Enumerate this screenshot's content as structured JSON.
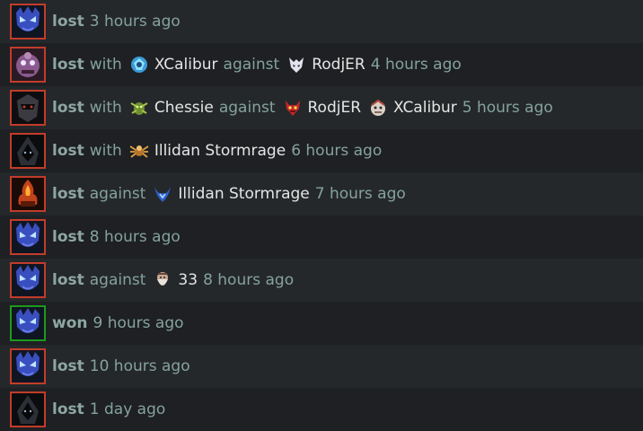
{
  "matches": [
    {
      "result": "lost",
      "time": "3 hours ago",
      "hero_icon": "blue-spirit-hero-icon",
      "frame": "loss"
    },
    {
      "result": "lost",
      "with_label": "with",
      "with": [
        {
          "name": "XCalibur",
          "icon": "blue-orb-hero-icon"
        }
      ],
      "against_label": "against",
      "against": [
        {
          "name": "RodjER",
          "icon": "pale-mask-hero-icon"
        }
      ],
      "time": "4 hours ago",
      "hero_icon": "purple-ogre-hero-icon",
      "frame": "loss"
    },
    {
      "result": "lost",
      "with_label": "with",
      "with": [
        {
          "name": "Chessie",
          "icon": "green-insect-hero-icon"
        }
      ],
      "against_label": "against",
      "against": [
        {
          "name": "RodjER",
          "icon": "red-demon-hero-icon"
        },
        {
          "name": "XCalibur",
          "icon": "white-ogre-hero-icon"
        }
      ],
      "time": "5 hours ago",
      "hero_icon": "dark-armor-hero-icon",
      "frame": "loss"
    },
    {
      "result": "lost",
      "with_label": "with",
      "with": [
        {
          "name": "Illidan Stormrage",
          "icon": "golden-spider-hero-icon"
        }
      ],
      "time": "6 hours ago",
      "hero_icon": "dark-hood-hero-icon",
      "frame": "loss"
    },
    {
      "result": "lost",
      "against_label": "against",
      "against": [
        {
          "name": "Illidan Stormrage",
          "icon": "blue-horns-hero-icon"
        }
      ],
      "time": "7 hours ago",
      "hero_icon": "flame-lord-hero-icon",
      "frame": "loss"
    },
    {
      "result": "lost",
      "time": "8 hours ago",
      "hero_icon": "blue-spirit-hero-icon",
      "frame": "loss"
    },
    {
      "result": "lost",
      "against_label": "against",
      "against": [
        {
          "name": "33",
          "icon": "bearded-dwarf-hero-icon"
        }
      ],
      "time": "8 hours ago",
      "hero_icon": "blue-spirit-hero-icon",
      "frame": "loss"
    },
    {
      "result": "won",
      "time": "9 hours ago",
      "hero_icon": "blue-spirit-hero-icon",
      "frame": "win"
    },
    {
      "result": "lost",
      "time": "10 hours ago",
      "hero_icon": "blue-spirit-hero-icon",
      "frame": "loss"
    },
    {
      "result": "lost",
      "time": "1 day ago",
      "hero_icon": "dark-hood-hero-icon",
      "frame": "loss"
    }
  ],
  "colors": {
    "loss_frame": "#c23c2a",
    "win_frame": "#1d9a1d",
    "muted_text": "#85a29d",
    "name_text": "#e3e6e4",
    "row_even": "#1e2023",
    "row_odd": "#25282b"
  }
}
